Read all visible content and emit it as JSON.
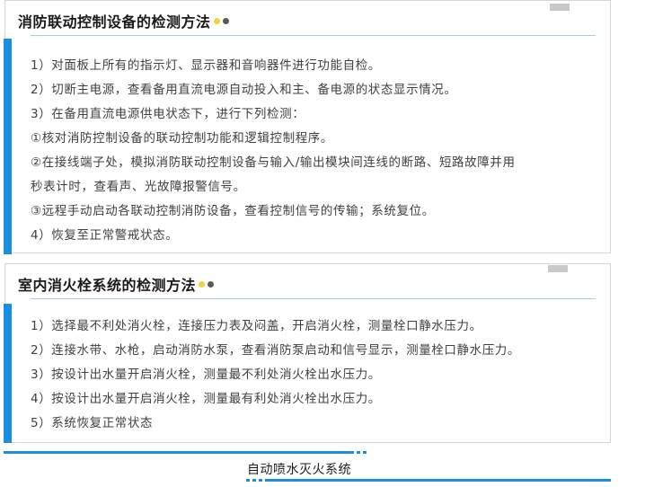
{
  "section1": {
    "title": "消防联动控制设备的检测方法",
    "lines": [
      "1）对面板上所有的指示灯、显示器和音响器件进行功能自检。",
      "2）切断主电源，查看备用直流电源自动投入和主、备电源的状态显示情况。",
      "3）在备用直流电源供电状态下，进行下列检测：",
      "①核对消防控制设备的联动控制功能和逻辑控制程序。",
      "②在接线端子处，模拟消防联动控制设备与输入/输出模块间连线的断路、短路故障并用",
      "秒表计时，查看声、光故障报警信号。",
      "③远程手动启动各联动控制消防设备，查看控制信号的传输；系统复位。",
      "4）恢复至正常警戒状态。"
    ]
  },
  "section2": {
    "title": "室内消火栓系统的检测方法",
    "lines": [
      "1）选择最不利处消火栓，连接压力表及闷盖，开启消火栓，测量栓口静水压力。",
      "2）连接水带、水枪，启动消防水泵，查看消防泵启动和信号显示，测量栓口静水压力。",
      "3）按设计出水量开启消火栓，测量最不利处消火栓出水压力。",
      "4）按设计出水量开启消火栓，测量最有利处消火栓出水压力。",
      "5）系统恢复正常状态"
    ]
  },
  "footer": {
    "text": "自动喷水灭火系统"
  },
  "colors": {
    "accent": "#1890e0",
    "rule": "#9cd3da",
    "dot_yellow": "#f5d33b",
    "dot_gray": "#5a5a5a"
  }
}
